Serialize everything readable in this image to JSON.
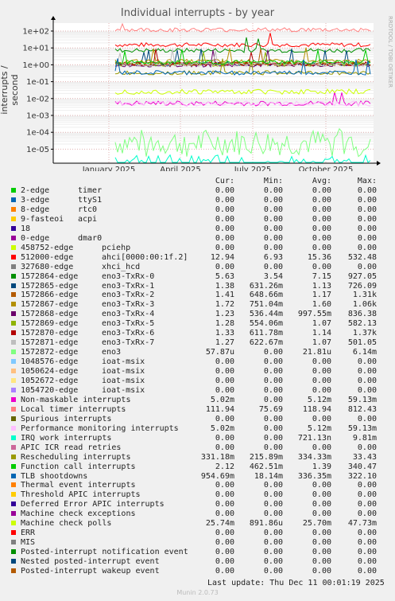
{
  "chart_data": {
    "type": "line",
    "title": "Individual interrupts - by year",
    "ylabel": "interrupts / second",
    "yscale": "log",
    "yticks": [
      "1e-05",
      "1e-04",
      "1e-03",
      "1e-02",
      "1e-01",
      "1e+00",
      "1e+01",
      "1e+02"
    ],
    "xticks": [
      "January 2025",
      "April 2025",
      "July 2025",
      "October 2025"
    ],
    "side_label": "RRDTOOL / TOBI OETIKER",
    "columns": [
      "Cur:",
      "Min:",
      "Avg:",
      "Max:"
    ],
    "series": [
      {
        "irq": "2-edge",
        "dev": "timer",
        "color": "#00cc00",
        "cur": "0.00",
        "min": "0.00",
        "avg": "0.00",
        "max": "0.00"
      },
      {
        "irq": "3-edge",
        "dev": "ttyS1",
        "color": "#0066b3",
        "cur": "0.00",
        "min": "0.00",
        "avg": "0.00",
        "max": "0.00"
      },
      {
        "irq": "8-edge",
        "dev": "rtc0",
        "color": "#ff8000",
        "cur": "0.00",
        "min": "0.00",
        "avg": "0.00",
        "max": "0.00"
      },
      {
        "irq": "9-fasteoi",
        "dev": "acpi",
        "color": "#ffcc00",
        "cur": "0.00",
        "min": "0.00",
        "avg": "0.00",
        "max": "0.00"
      },
      {
        "irq": "18",
        "dev": "",
        "color": "#330099",
        "cur": "0.00",
        "min": "0.00",
        "avg": "0.00",
        "max": "0.00"
      },
      {
        "irq": "0-edge",
        "dev": "dmar0",
        "color": "#990099",
        "cur": "0.00",
        "min": "0.00",
        "avg": "0.00",
        "max": "0.00"
      },
      {
        "irq": "458752-edge",
        "dev": "pciehp",
        "color": "#ccff00",
        "cur": "0.00",
        "min": "0.00",
        "avg": "0.00",
        "max": "0.00"
      },
      {
        "irq": "512000-edge",
        "dev": "ahci[0000:00:1f.2]",
        "color": "#ff0000",
        "cur": "12.94",
        "min": "6.93",
        "avg": "15.36",
        "max": "532.48"
      },
      {
        "irq": "327680-edge",
        "dev": "xhci_hcd",
        "color": "#808080",
        "cur": "0.00",
        "min": "0.00",
        "avg": "0.00",
        "max": "0.00"
      },
      {
        "irq": "1572864-edge",
        "dev": "eno3-TxRx-0",
        "color": "#008f00",
        "cur": "5.63",
        "min": "3.54",
        "avg": "7.15",
        "max": "927.05"
      },
      {
        "irq": "1572865-edge",
        "dev": "eno3-TxRx-1",
        "color": "#00487d",
        "cur": "1.38",
        "min": "631.26m",
        "avg": "1.13",
        "max": "726.09"
      },
      {
        "irq": "1572866-edge",
        "dev": "eno3-TxRx-2",
        "color": "#b35a00",
        "cur": "1.41",
        "min": "648.66m",
        "avg": "1.17",
        "max": "1.31k"
      },
      {
        "irq": "1572867-edge",
        "dev": "eno3-TxRx-3",
        "color": "#b38f00",
        "cur": "1.72",
        "min": "751.04m",
        "avg": "1.60",
        "max": "1.06k"
      },
      {
        "irq": "1572868-edge",
        "dev": "eno3-TxRx-4",
        "color": "#6b006b",
        "cur": "1.23",
        "min": "536.44m",
        "avg": "997.55m",
        "max": "836.38"
      },
      {
        "irq": "1572869-edge",
        "dev": "eno3-TxRx-5",
        "color": "#8fb300",
        "cur": "1.28",
        "min": "554.06m",
        "avg": "1.07",
        "max": "582.13"
      },
      {
        "irq": "1572870-edge",
        "dev": "eno3-TxRx-6",
        "color": "#b30000",
        "cur": "1.33",
        "min": "611.78m",
        "avg": "1.14",
        "max": "1.37k"
      },
      {
        "irq": "1572871-edge",
        "dev": "eno3-TxRx-7",
        "color": "#bebebe",
        "cur": "1.27",
        "min": "622.67m",
        "avg": "1.07",
        "max": "501.05"
      },
      {
        "irq": "1572872-edge",
        "dev": "eno3",
        "color": "#80ff80",
        "cur": "57.87u",
        "min": "0.00",
        "avg": "21.81u",
        "max": "6.14m"
      },
      {
        "irq": "1048576-edge",
        "dev": "ioat-msix",
        "color": "#80c9ff",
        "cur": "0.00",
        "min": "0.00",
        "avg": "0.00",
        "max": "0.00"
      },
      {
        "irq": "1050624-edge",
        "dev": "ioat-msix",
        "color": "#ffc080",
        "cur": "0.00",
        "min": "0.00",
        "avg": "0.00",
        "max": "0.00"
      },
      {
        "irq": "1052672-edge",
        "dev": "ioat-msix",
        "color": "#ffe680",
        "cur": "0.00",
        "min": "0.00",
        "avg": "0.00",
        "max": "0.00"
      },
      {
        "irq": "1054720-edge",
        "dev": "ioat-msix",
        "color": "#aa80ff",
        "cur": "0.00",
        "min": "0.00",
        "avg": "0.00",
        "max": "0.00"
      },
      {
        "irq": "Non-maskable interrupts",
        "dev": "",
        "color": "#ee00cc",
        "cur": "5.02m",
        "min": "0.00",
        "avg": "5.12m",
        "max": "59.13m"
      },
      {
        "irq": "Local timer interrupts",
        "dev": "",
        "color": "#ff8080",
        "cur": "111.94",
        "min": "75.69",
        "avg": "118.94",
        "max": "812.43"
      },
      {
        "irq": "Spurious interrupts",
        "dev": "",
        "color": "#666600",
        "cur": "0.00",
        "min": "0.00",
        "avg": "0.00",
        "max": "0.00"
      },
      {
        "irq": "Performance monitoring interrupts",
        "dev": "",
        "color": "#ffbfff",
        "cur": "5.02m",
        "min": "0.00",
        "avg": "5.12m",
        "max": "59.13m"
      },
      {
        "irq": "IRQ work interrupts",
        "dev": "",
        "color": "#00ffcc",
        "cur": "0.00",
        "min": "0.00",
        "avg": "721.13n",
        "max": "9.81m"
      },
      {
        "irq": "APIC ICR read retries",
        "dev": "",
        "color": "#cc6699",
        "cur": "0.00",
        "min": "0.00",
        "avg": "0.00",
        "max": "0.00"
      },
      {
        "irq": "Rescheduling interrupts",
        "dev": "",
        "color": "#999900",
        "cur": "331.18m",
        "min": "215.89m",
        "avg": "334.33m",
        "max": "33.43"
      },
      {
        "irq": "Function call interrupts",
        "dev": "",
        "color": "#00cc00",
        "cur": "2.12",
        "min": "462.51m",
        "avg": "1.39",
        "max": "340.47"
      },
      {
        "irq": "TLB shootdowns",
        "dev": "",
        "color": "#0066b3",
        "cur": "954.69m",
        "min": "18.14m",
        "avg": "336.35m",
        "max": "322.10"
      },
      {
        "irq": "Thermal event interrupts",
        "dev": "",
        "color": "#ff8000",
        "cur": "0.00",
        "min": "0.00",
        "avg": "0.00",
        "max": "0.00"
      },
      {
        "irq": "Threshold APIC interrupts",
        "dev": "",
        "color": "#ffcc00",
        "cur": "0.00",
        "min": "0.00",
        "avg": "0.00",
        "max": "0.00"
      },
      {
        "irq": "Deferred Error APIC interrupts",
        "dev": "",
        "color": "#330099",
        "cur": "0.00",
        "min": "0.00",
        "avg": "0.00",
        "max": "0.00"
      },
      {
        "irq": "Machine check exceptions",
        "dev": "",
        "color": "#990099",
        "cur": "0.00",
        "min": "0.00",
        "avg": "0.00",
        "max": "0.00"
      },
      {
        "irq": "Machine check polls",
        "dev": "",
        "color": "#ccff00",
        "cur": "25.74m",
        "min": "891.86u",
        "avg": "25.70m",
        "max": "47.73m"
      },
      {
        "irq": "ERR",
        "dev": "",
        "color": "#ff0000",
        "cur": "0.00",
        "min": "0.00",
        "avg": "0.00",
        "max": "0.00"
      },
      {
        "irq": "MIS",
        "dev": "",
        "color": "#808080",
        "cur": "0.00",
        "min": "0.00",
        "avg": "0.00",
        "max": "0.00"
      },
      {
        "irq": "Posted-interrupt notification event",
        "dev": "",
        "color": "#008f00",
        "cur": "0.00",
        "min": "0.00",
        "avg": "0.00",
        "max": "0.00"
      },
      {
        "irq": "Nested posted-interrupt event",
        "dev": "",
        "color": "#00487d",
        "cur": "0.00",
        "min": "0.00",
        "avg": "0.00",
        "max": "0.00"
      },
      {
        "irq": "Posted-interrupt wakeup event",
        "dev": "",
        "color": "#b35a00",
        "cur": "0.00",
        "min": "0.00",
        "avg": "0.00",
        "max": "0.00"
      }
    ],
    "last_update": "Last update: Thu Dec 11 00:01:19 2025",
    "footer": "Munin 2.0.73"
  }
}
